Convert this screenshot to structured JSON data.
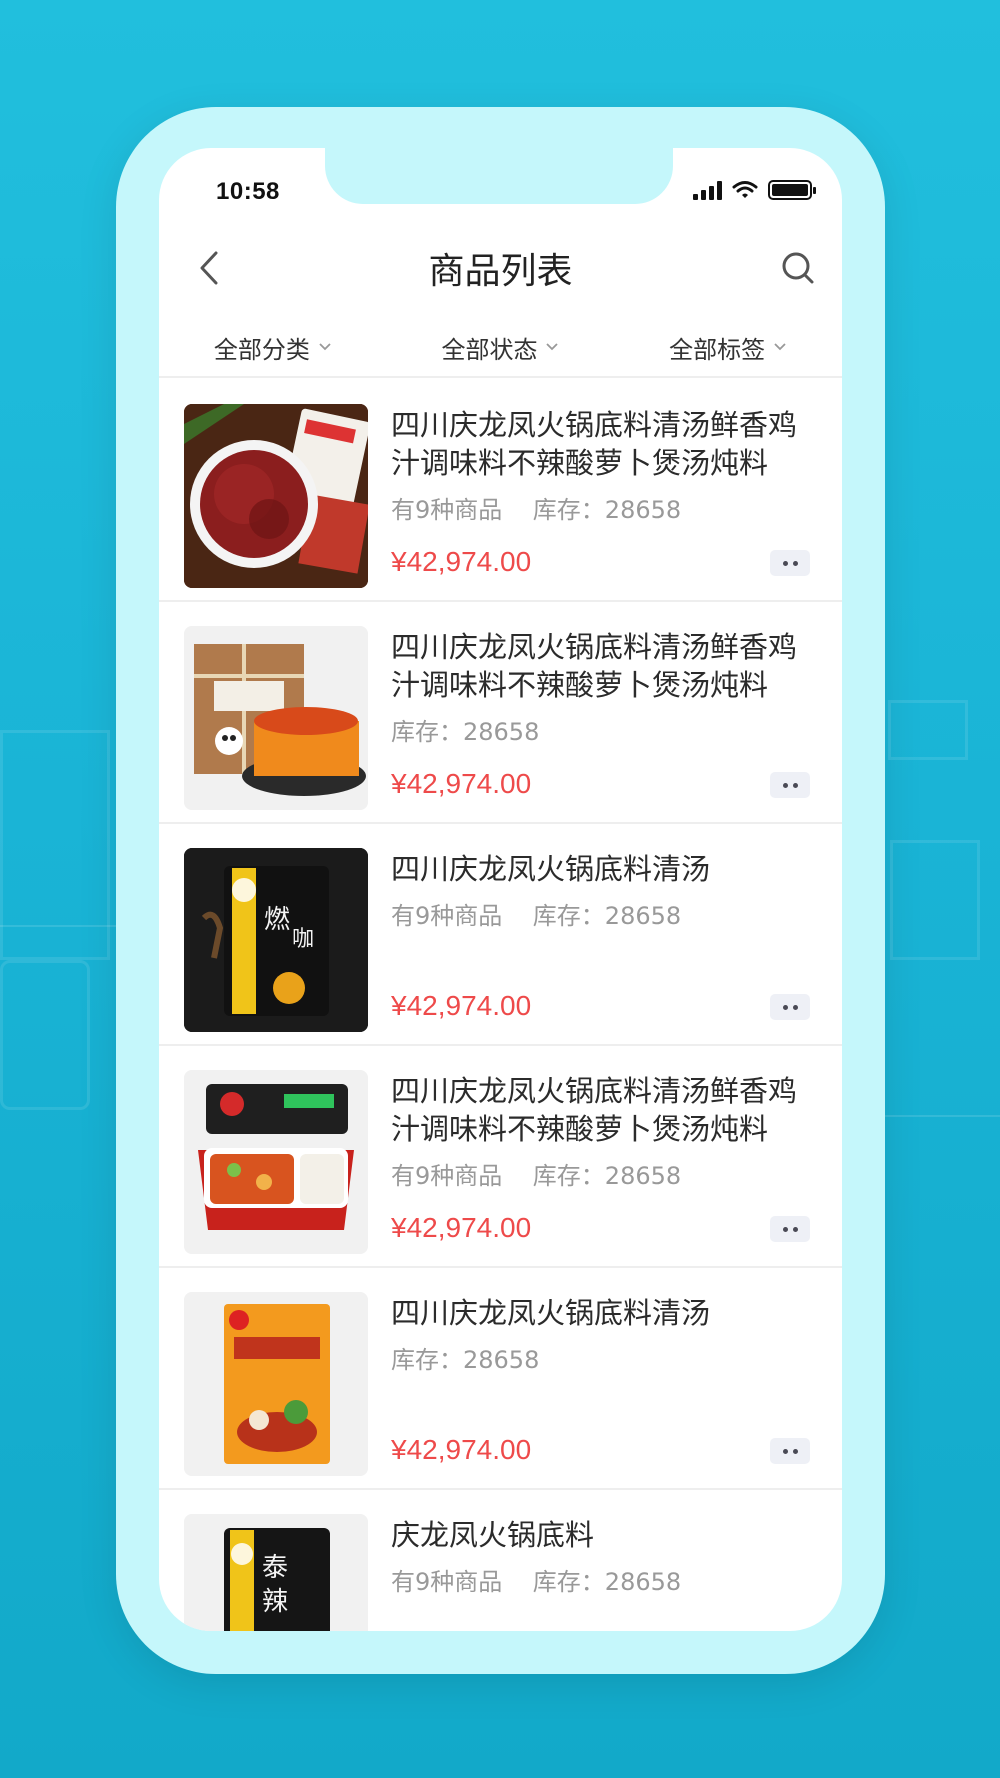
{
  "status_bar": {
    "time": "10:58"
  },
  "nav": {
    "title": "商品列表"
  },
  "filters": [
    {
      "label": "全部分类"
    },
    {
      "label": "全部状态"
    },
    {
      "label": "全部标签"
    }
  ],
  "products": [
    {
      "title": "四川庆龙凤火锅底料清汤鲜香鸡汁调味料不辣酸萝卜煲汤炖料",
      "variants": "有9种商品",
      "stock": "库存：28658",
      "price": "¥42,974.00",
      "image": "sichuan-pepper"
    },
    {
      "title": "四川庆龙凤火锅底料清汤鲜香鸡汁调味料不辣酸萝卜煲汤炖料",
      "variants": "",
      "stock": "库存：28658",
      "price": "¥42,974.00",
      "image": "hotpot-block"
    },
    {
      "title": "四川庆龙凤火锅底料清汤",
      "variants": "有9种商品",
      "stock": "库存：28658",
      "price": "¥42,974.00",
      "image": "curry-pouch"
    },
    {
      "title": "四川庆龙凤火锅底料清汤鲜香鸡汁调味料不辣酸萝卜煲汤炖料",
      "variants": "有9种商品",
      "stock": "库存：28658",
      "price": "¥42,974.00",
      "image": "self-heating-hotpot"
    },
    {
      "title": "四川庆龙凤火锅底料清汤",
      "variants": "",
      "stock": "库存：28658",
      "price": "¥42,974.00",
      "image": "hotpot-base-bag"
    },
    {
      "title": "庆龙凤火锅底料",
      "variants": "有9种商品",
      "stock": "库存：28658",
      "price": "",
      "image": "sour-spicy-pouch"
    }
  ],
  "colors": {
    "background": "#1ab4d6",
    "phone_frame": "#c5f7fb",
    "price": "#ee4a4a"
  }
}
